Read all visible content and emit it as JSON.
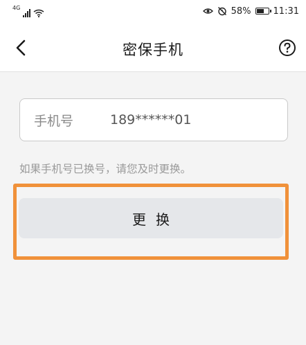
{
  "status_bar": {
    "network": "4G",
    "battery": "58%",
    "time": "11:31"
  },
  "nav": {
    "title": "密保手机",
    "back_icon": "chevron-left-icon",
    "help_icon": "question-circle-icon"
  },
  "phone": {
    "label": "手机号",
    "value": "189******01"
  },
  "hint": "如果手机号已换号，请您及时更换。",
  "action": {
    "change_label": "更换"
  },
  "colors": {
    "highlight": "#f0913a",
    "button_bg": "#e5e7ea",
    "page_bg": "#f4f4f4"
  }
}
